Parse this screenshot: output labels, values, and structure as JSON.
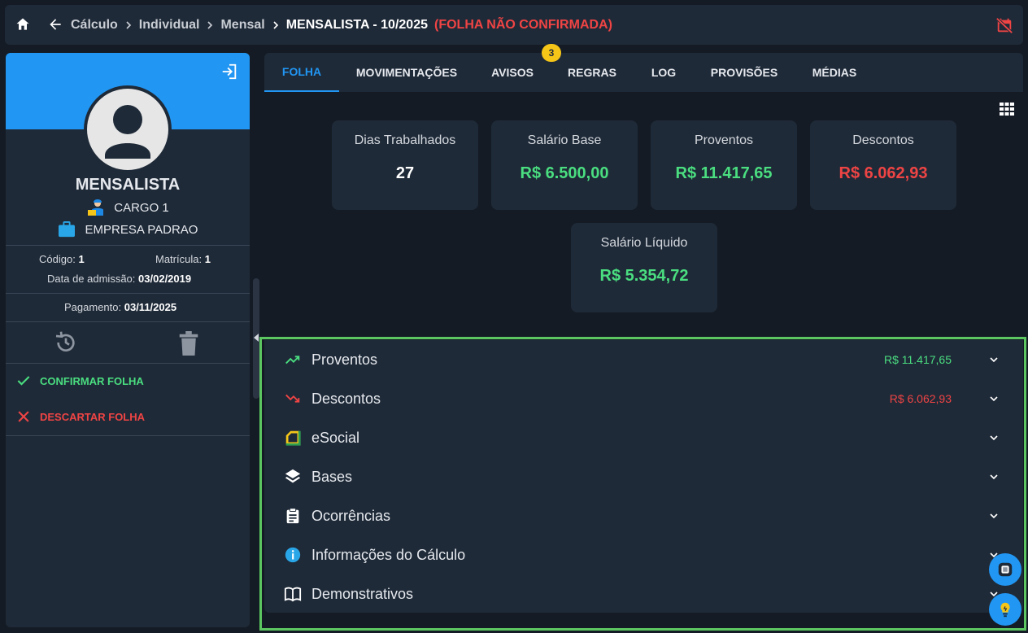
{
  "breadcrumb": {
    "items": [
      "Cálculo",
      "Individual",
      "Mensal"
    ],
    "current": "MENSALISTA - 10/2025",
    "status": "(FOLHA NÃO CONFIRMADA)"
  },
  "employee": {
    "name": "MENSALISTA",
    "cargo": "CARGO 1",
    "empresa": "EMPRESA PADRAO",
    "codigo_label": "Código:",
    "codigo": "1",
    "matricula_label": "Matrícula:",
    "matricula": "1",
    "admissao_label": "Data de admissão:",
    "admissao": "03/02/2019",
    "pagamento_label": "Pagamento:",
    "pagamento": "03/11/2025"
  },
  "actions": {
    "confirm": "CONFIRMAR FOLHA",
    "discard": "DESCARTAR FOLHA"
  },
  "tabs": [
    "FOLHA",
    "MOVIMENTAÇÕES",
    "AVISOS",
    "REGRAS",
    "LOG",
    "PROVISÕES",
    "MÉDIAS"
  ],
  "avisos_badge": "3",
  "cards": {
    "dias": {
      "label": "Dias Trabalhados",
      "value": "27"
    },
    "salario_base": {
      "label": "Salário Base",
      "value": "R$ 6.500,00"
    },
    "proventos": {
      "label": "Proventos",
      "value": "R$ 11.417,65"
    },
    "descontos": {
      "label": "Descontos",
      "value": "R$ 6.062,93"
    },
    "liquido": {
      "label": "Salário Líquido",
      "value": "R$ 5.354,72"
    }
  },
  "sections": [
    {
      "title": "Proventos",
      "amount": "R$ 11.417,65"
    },
    {
      "title": "Descontos",
      "amount": "R$ 6.062,93"
    },
    {
      "title": "eSocial",
      "amount": ""
    },
    {
      "title": "Bases",
      "amount": ""
    },
    {
      "title": "Ocorrências",
      "amount": ""
    },
    {
      "title": "Informações do Cálculo",
      "amount": ""
    },
    {
      "title": "Demonstrativos",
      "amount": ""
    }
  ],
  "colors": {
    "accent": "#2196f3",
    "positive": "#4ade80",
    "negative": "#ef4444",
    "highlight_border": "#5cc761",
    "badge": "#f5c518"
  },
  "icons": [
    "home-icon",
    "arrow-left-icon",
    "calendar-off-icon",
    "logout-icon",
    "history-icon",
    "trash-icon",
    "check-icon",
    "close-icon",
    "trending-up-icon",
    "trending-down-icon",
    "esocial-icon",
    "layers-icon",
    "clipboard-icon",
    "info-icon",
    "book-icon",
    "grid-icon",
    "chevron-down-icon",
    "chat-icon",
    "lightbulb-icon"
  ]
}
